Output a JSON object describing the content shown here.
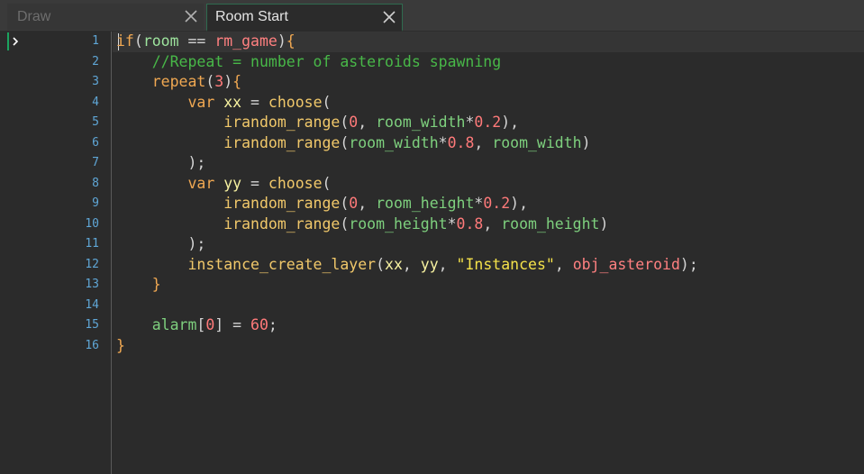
{
  "tabs": [
    {
      "label": "Draw",
      "active": false
    },
    {
      "label": "Room Start",
      "active": true
    }
  ],
  "editor": {
    "current_line": 1,
    "line_numbers": [
      "1",
      "2",
      "3",
      "4",
      "5",
      "6",
      "7",
      "8",
      "9",
      "10",
      "11",
      "12",
      "13",
      "14",
      "15",
      "16"
    ],
    "lines": [
      [
        [
          "kw",
          "if"
        ],
        [
          "pl",
          "("
        ],
        [
          "var",
          "room"
        ],
        [
          "pl",
          " == "
        ],
        [
          "obj",
          "rm_game"
        ],
        [
          "pl",
          ")"
        ],
        [
          "br",
          "{"
        ]
      ],
      [
        [
          "pl",
          "    "
        ],
        [
          "cmt",
          "//Repeat = number of asteroids spawning"
        ]
      ],
      [
        [
          "pl",
          "    "
        ],
        [
          "kw",
          "repeat"
        ],
        [
          "pl",
          "("
        ],
        [
          "num",
          "3"
        ],
        [
          "pl",
          ")"
        ],
        [
          "br",
          "{"
        ]
      ],
      [
        [
          "pl",
          "        "
        ],
        [
          "kw",
          "var"
        ],
        [
          "pl",
          " "
        ],
        [
          "loc",
          "xx"
        ],
        [
          "pl",
          " = "
        ],
        [
          "fn",
          "choose"
        ],
        [
          "pl",
          "("
        ]
      ],
      [
        [
          "pl",
          "            "
        ],
        [
          "fn",
          "irandom_range"
        ],
        [
          "pl",
          "("
        ],
        [
          "num",
          "0"
        ],
        [
          "pl",
          ", "
        ],
        [
          "grn",
          "room_width"
        ],
        [
          "pl",
          "*"
        ],
        [
          "num",
          "0.2"
        ],
        [
          "pl",
          "),"
        ]
      ],
      [
        [
          "pl",
          "            "
        ],
        [
          "fn",
          "irandom_range"
        ],
        [
          "pl",
          "("
        ],
        [
          "grn",
          "room_width"
        ],
        [
          "pl",
          "*"
        ],
        [
          "num",
          "0.8"
        ],
        [
          "pl",
          ", "
        ],
        [
          "grn",
          "room_width"
        ],
        [
          "pl",
          ")"
        ]
      ],
      [
        [
          "pl",
          "        );"
        ]
      ],
      [
        [
          "pl",
          "        "
        ],
        [
          "kw",
          "var"
        ],
        [
          "pl",
          " "
        ],
        [
          "loc",
          "yy"
        ],
        [
          "pl",
          " = "
        ],
        [
          "fn",
          "choose"
        ],
        [
          "pl",
          "("
        ]
      ],
      [
        [
          "pl",
          "            "
        ],
        [
          "fn",
          "irandom_range"
        ],
        [
          "pl",
          "("
        ],
        [
          "num",
          "0"
        ],
        [
          "pl",
          ", "
        ],
        [
          "grn",
          "room_height"
        ],
        [
          "pl",
          "*"
        ],
        [
          "num",
          "0.2"
        ],
        [
          "pl",
          "),"
        ]
      ],
      [
        [
          "pl",
          "            "
        ],
        [
          "fn",
          "irandom_range"
        ],
        [
          "pl",
          "("
        ],
        [
          "grn",
          "room_height"
        ],
        [
          "pl",
          "*"
        ],
        [
          "num",
          "0.8"
        ],
        [
          "pl",
          ", "
        ],
        [
          "grn",
          "room_height"
        ],
        [
          "pl",
          ")"
        ]
      ],
      [
        [
          "pl",
          "        );"
        ]
      ],
      [
        [
          "pl",
          "        "
        ],
        [
          "fn",
          "instance_create_layer"
        ],
        [
          "pl",
          "("
        ],
        [
          "loc",
          "xx"
        ],
        [
          "pl",
          ", "
        ],
        [
          "loc",
          "yy"
        ],
        [
          "pl",
          ", "
        ],
        [
          "str",
          "\"Instances\""
        ],
        [
          "pl",
          ", "
        ],
        [
          "obj",
          "obj_asteroid"
        ],
        [
          "pl",
          ");"
        ]
      ],
      [
        [
          "pl",
          "    "
        ],
        [
          "br",
          "}"
        ]
      ],
      [
        [
          "pl",
          ""
        ]
      ],
      [
        [
          "pl",
          "    "
        ],
        [
          "grn",
          "alarm"
        ],
        [
          "pl",
          "["
        ],
        [
          "num",
          "0"
        ],
        [
          "pl",
          "] = "
        ],
        [
          "num",
          "60"
        ],
        [
          "pl",
          ";"
        ]
      ],
      [
        [
          "br",
          "}"
        ]
      ]
    ]
  },
  "colors": {
    "background": "#2b2b2b",
    "line_number": "#5fa6d6",
    "keyword": "#f0a852",
    "comment": "#48b848",
    "number": "#ff7a7a",
    "string": "#f5e24a",
    "function": "#f1c86a",
    "builtin_var": "#7ed07e",
    "asset": "#ff8080",
    "local_var": "#f6f1a0",
    "active_tab_border": "#2f6b4f",
    "gutter_mark": "#1ba35f"
  },
  "icons": {
    "tab_close": "close-icon",
    "fold": "fold-arrow-icon"
  }
}
